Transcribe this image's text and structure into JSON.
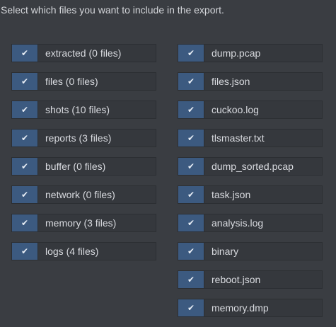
{
  "instructions": "Select which files you want to include in the export.",
  "check_glyph": "✔",
  "colors": {
    "background": "#3a3d42",
    "checkbox_fill": "#3c5a80",
    "item_background": "#35383d"
  },
  "left_items": [
    {
      "label": "extracted (0 files)",
      "checked": true
    },
    {
      "label": "files (0 files)",
      "checked": true
    },
    {
      "label": "shots (10 files)",
      "checked": true
    },
    {
      "label": "reports (3 files)",
      "checked": true
    },
    {
      "label": "buffer (0 files)",
      "checked": true
    },
    {
      "label": "network (0 files)",
      "checked": true
    },
    {
      "label": "memory (3 files)",
      "checked": true
    },
    {
      "label": "logs (4 files)",
      "checked": true
    }
  ],
  "right_items": [
    {
      "label": "dump.pcap",
      "checked": true
    },
    {
      "label": "files.json",
      "checked": true
    },
    {
      "label": "cuckoo.log",
      "checked": true
    },
    {
      "label": "tlsmaster.txt",
      "checked": true
    },
    {
      "label": "dump_sorted.pcap",
      "checked": true
    },
    {
      "label": "task.json",
      "checked": true
    },
    {
      "label": "analysis.log",
      "checked": true
    },
    {
      "label": "binary",
      "checked": true
    },
    {
      "label": "reboot.json",
      "checked": true
    },
    {
      "label": "memory.dmp",
      "checked": true
    }
  ]
}
